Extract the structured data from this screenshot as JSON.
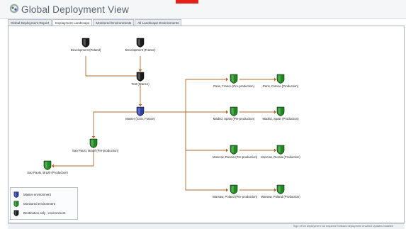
{
  "window": {
    "title": "Global Deployment View",
    "icon": "deployment-icon"
  },
  "tabs": [
    {
      "label": "Global Deployment Report",
      "active": false
    },
    {
      "label": "Deployment Landscape",
      "active": true
    },
    {
      "label": "Monitored Environments",
      "active": false
    },
    {
      "label": "All Landscape Environments",
      "active": false
    }
  ],
  "colors": {
    "master": "#2f3fa8",
    "monitored": "#1e8a1e",
    "destination": "#1a1a1a",
    "edge": "#b06a2a",
    "accent_red": "#e32119"
  },
  "nodes": {
    "dev_poland": {
      "label": "Development (Poland)",
      "type": "destination"
    },
    "dev_france": {
      "label": "Development (France)",
      "type": "destination"
    },
    "test_france": {
      "label": "Test (France)",
      "type": "destination"
    },
    "master": {
      "label": "Master (CSS, France)",
      "type": "master"
    },
    "sp_pre": {
      "label": "Sao Paulo, Brazil (Pre-production)",
      "type": "monitored"
    },
    "sp_prod": {
      "label": "Sao Paulo, Brazil (Production)",
      "type": "monitored"
    },
    "paris_pre": {
      "label": "Paris, France (Pre-production)",
      "type": "monitored"
    },
    "paris_prod": {
      "label": "Paris, France (Production)",
      "type": "monitored"
    },
    "madrid_pre": {
      "label": "Madrid, Spain (Pre-production)",
      "type": "monitored"
    },
    "madrid_prod": {
      "label": "Madrid, Spain (Production)",
      "type": "monitored"
    },
    "moscow_pre": {
      "label": "Moscow, Russia (Pre-production)",
      "type": "monitored"
    },
    "moscow_prod": {
      "label": "Moscow, Russia (Production)",
      "type": "monitored"
    },
    "warsaw_pre": {
      "label": "Warsaw, Poland (Pre-production)",
      "type": "monitored"
    },
    "warsaw_prod": {
      "label": "Warsaw, Poland (Production)",
      "type": "monitored"
    }
  },
  "legend": {
    "master": "Master environment",
    "monitored": "Monitored environment",
    "destination": "Destination only - environment"
  },
  "status": "Sign off on deployment not required   Rollback deployment enabled   Updates installed"
}
